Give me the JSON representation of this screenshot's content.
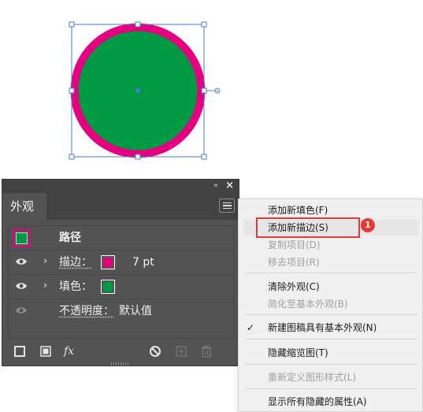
{
  "colors": {
    "fill": "#009944",
    "stroke": "#e4007f",
    "selection": "#4a78d8",
    "panel_bg": "#535353",
    "menu_bg": "#f0f0f0",
    "annotation": "#e53935"
  },
  "panel": {
    "tab_label": "外观",
    "collapse_glyph": "«",
    "close_glyph": "×",
    "menu_icon": "hamburger-icon",
    "object_label": "路径",
    "rows": [
      {
        "label": "描边：",
        "value": "7 pt",
        "swatch_color": "#e4007f",
        "icon": "eye-icon"
      },
      {
        "label": "填色：",
        "value": "",
        "swatch_color": "#009944",
        "icon": "eye-icon"
      },
      {
        "label": "不透明度：",
        "value": "默认值",
        "icon": "eye-icon"
      }
    ],
    "footer_icons": [
      "new-stroke-icon",
      "new-fill-icon",
      "fx-icon",
      "clear-appearance-icon",
      "duplicate-item-icon",
      "trash-icon"
    ],
    "fx_label": "fx"
  },
  "context_menu": {
    "items": [
      {
        "label": "添加新填色(F)",
        "enabled": true
      },
      {
        "label": "添加新描边(S)",
        "enabled": true,
        "highlighted": true
      },
      {
        "label": "复制项目(D)",
        "enabled": false
      },
      {
        "label": "移去项目(R)",
        "enabled": false
      },
      {
        "label": "清除外观(C)",
        "enabled": true
      },
      {
        "label": "简化至基本外观(B)",
        "enabled": false
      },
      {
        "label": "新建图稿具有基本外观(N)",
        "enabled": true,
        "checked": true
      },
      {
        "label": "隐藏缩览图(T)",
        "enabled": true
      },
      {
        "label": "重新定义图形样式(L)",
        "enabled": false
      },
      {
        "label": "显示所有隐藏的属性(A)",
        "enabled": true
      }
    ],
    "check_glyph": "✓"
  },
  "annotation": {
    "step": "1"
  }
}
